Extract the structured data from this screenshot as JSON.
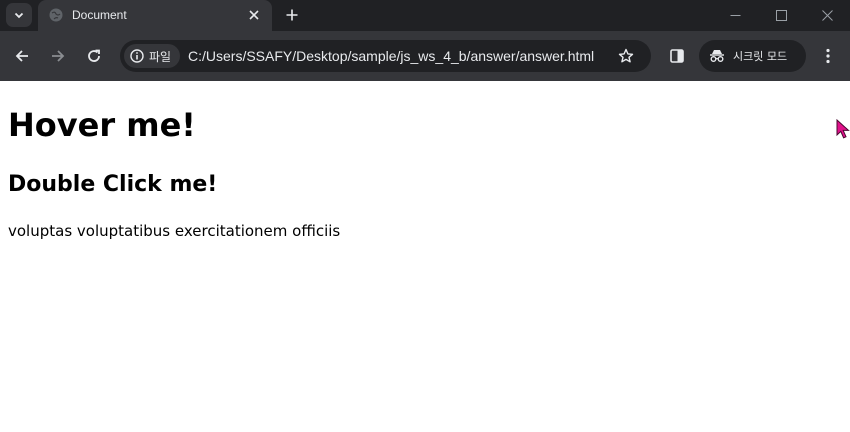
{
  "browser": {
    "tab": {
      "title": "Document",
      "favicon": "globe-icon"
    },
    "toolbar": {
      "site_chip_label": "파일",
      "url": "C:/Users/SSAFY/Desktop/sample/js_ws_4_b/answer/answer.html",
      "incognito_label": "시크릿 모드"
    },
    "colors": {
      "tabstrip_bg": "#202124",
      "toolbar_bg": "#35363a",
      "omnibox_bg": "#202124",
      "text": "#e8eaed",
      "cursor": "#e0118a"
    }
  },
  "page": {
    "heading1": "Hover me!",
    "heading2": "Double Click me!",
    "paragraph": "voluptas voluptatibus exercitationem officiis"
  }
}
